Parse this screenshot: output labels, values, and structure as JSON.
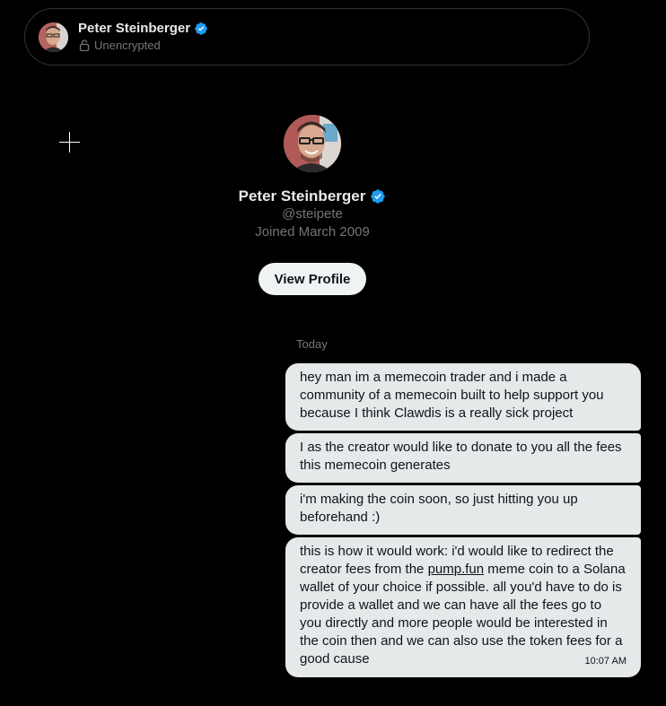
{
  "header": {
    "name": "Peter Steinberger",
    "status": "Unencrypted"
  },
  "profile": {
    "name": "Peter Steinberger",
    "handle": "@steipete",
    "joined": "Joined March 2009",
    "view_profile_label": "View Profile"
  },
  "conversation": {
    "date_label": "Today",
    "messages": [
      {
        "text": "hey man im a memecoin trader and i made a community of a memecoin built to help support you because I think Clawdis is a really sick project"
      },
      {
        "text": "I as the creator would like to donate to you all the fees this memecoin generates"
      },
      {
        "text": "i'm making the coin soon, so just hitting you up beforehand :)"
      },
      {
        "text_before_link": "this is how it would work: i'd would like to redirect the creator fees from the ",
        "link": "pump.fun",
        "text_after_link": " meme coin to a Solana wallet of your choice if possible. all you'd have to do is provide a wallet and we can have all the fees go to you directly and more people would be interested in the coin then and we can also use the token fees for a good cause",
        "time": "10:07 AM"
      }
    ]
  },
  "colors": {
    "background": "#000000",
    "bubble": "#e6e9ea",
    "verified": "#1d9bf0",
    "muted_text": "#71767b"
  },
  "icons": [
    "verified-badge-icon",
    "lock-icon",
    "crosshair-icon"
  ]
}
